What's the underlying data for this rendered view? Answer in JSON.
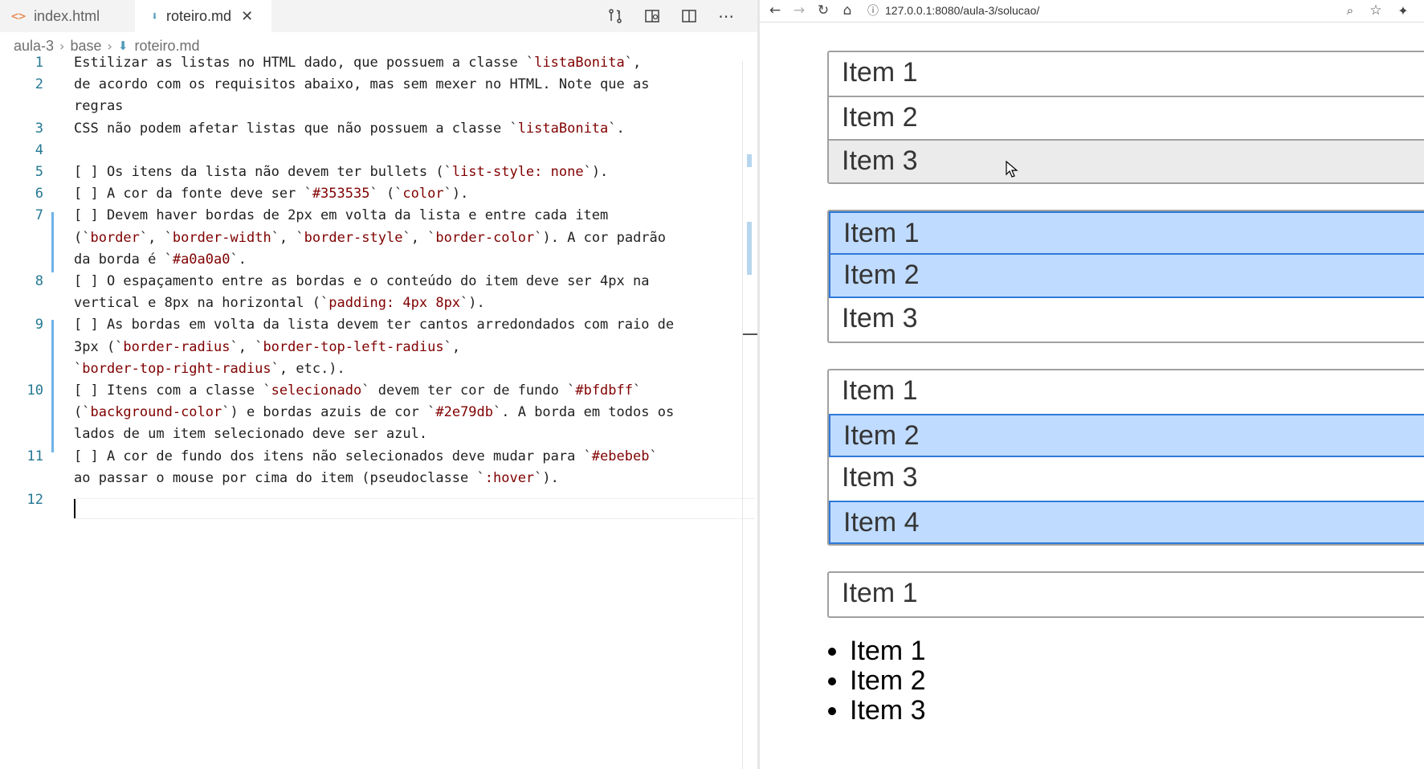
{
  "editor": {
    "tabs": [
      {
        "icon": "html-file-icon",
        "label": "index.html",
        "active": false
      },
      {
        "icon": "markdown-file-icon",
        "label": "roteiro.md",
        "active": true
      }
    ],
    "breadcrumb": [
      "aula-3",
      "base",
      "roteiro.md"
    ],
    "line_numbers": [
      "1",
      "2",
      "3",
      "4",
      "5",
      "6",
      "7",
      "8",
      "9",
      "10",
      "11",
      "12"
    ],
    "lines": [
      {
        "n": "1",
        "segs": [
          {
            "t": "Estilizar as listas no HTML dado, que possuem a classe `"
          },
          {
            "t": "listaBonita",
            "c": 1
          },
          {
            "t": "`,"
          }
        ]
      },
      {
        "segs": [
          {
            "t": "de acordo com os requisitos abaixo, mas sem mexer no HTML. Note que as"
          }
        ],
        "n": "2"
      },
      {
        "segs": [
          {
            "t": "regras"
          }
        ]
      },
      {
        "n": "3",
        "segs": [
          {
            "t": "CSS não podem afetar listas que não possuem a classe `"
          },
          {
            "t": "listaBonita",
            "c": 1
          },
          {
            "t": "`."
          }
        ]
      },
      {
        "n": "4",
        "segs": [
          {
            "t": ""
          }
        ]
      },
      {
        "n": "5",
        "segs": [
          {
            "t": "[ ] Os itens da lista não devem ter bullets (`"
          },
          {
            "t": "list-style: none",
            "c": 1
          },
          {
            "t": "`)."
          }
        ]
      },
      {
        "n": "6",
        "segs": [
          {
            "t": "[ ] A cor da fonte deve ser `"
          },
          {
            "t": "#353535",
            "c": 1
          },
          {
            "t": "` (`"
          },
          {
            "t": "color",
            "c": 1
          },
          {
            "t": "`)."
          }
        ]
      },
      {
        "n": "7",
        "segs": [
          {
            "t": "[ ] Devem haver bordas de 2px em volta da lista e entre cada item"
          }
        ]
      },
      {
        "segs": [
          {
            "t": "(`"
          },
          {
            "t": "border",
            "c": 1
          },
          {
            "t": "`, `"
          },
          {
            "t": "border-width",
            "c": 1
          },
          {
            "t": "`, `"
          },
          {
            "t": "border-style",
            "c": 1
          },
          {
            "t": "`, `"
          },
          {
            "t": "border-color",
            "c": 1
          },
          {
            "t": "`). A cor padrão"
          }
        ]
      },
      {
        "segs": [
          {
            "t": "da borda é `"
          },
          {
            "t": "#a0a0a0",
            "c": 1
          },
          {
            "t": "`."
          }
        ]
      },
      {
        "n": "8",
        "segs": [
          {
            "t": "[ ] O espaçamento entre as bordas e o conteúdo do item deve ser 4px na"
          }
        ]
      },
      {
        "segs": [
          {
            "t": "vertical e 8px na horizontal (`"
          },
          {
            "t": "padding: 4px 8px",
            "c": 1
          },
          {
            "t": "`)."
          }
        ]
      },
      {
        "n": "9",
        "segs": [
          {
            "t": "[ ] As bordas em volta da lista devem ter cantos arredondados com raio de"
          }
        ]
      },
      {
        "segs": [
          {
            "t": "3px (`"
          },
          {
            "t": "border-radius",
            "c": 1
          },
          {
            "t": "`, `"
          },
          {
            "t": "border-top-left-radius",
            "c": 1
          },
          {
            "t": "`,"
          }
        ]
      },
      {
        "segs": [
          {
            "t": "`"
          },
          {
            "t": "border-top-right-radius",
            "c": 1
          },
          {
            "t": "`, etc.)."
          }
        ]
      },
      {
        "n": "10",
        "segs": [
          {
            "t": "[ ] Itens com a classe `"
          },
          {
            "t": "selecionado",
            "c": 1
          },
          {
            "t": "` devem ter cor de fundo `"
          },
          {
            "t": "#bfdbff",
            "c": 1
          },
          {
            "t": "`"
          }
        ]
      },
      {
        "segs": [
          {
            "t": "(`"
          },
          {
            "t": "background-color",
            "c": 1
          },
          {
            "t": "`) e bordas azuis de cor `"
          },
          {
            "t": "#2e79db",
            "c": 1
          },
          {
            "t": "`. A borda em todos os"
          }
        ]
      },
      {
        "segs": [
          {
            "t": "lados de um item selecionado deve ser azul."
          }
        ]
      },
      {
        "n": "11",
        "segs": [
          {
            "t": "[ ] A cor de fundo dos itens não selecionados deve mudar para `"
          },
          {
            "t": "#ebebeb",
            "c": 1
          },
          {
            "t": "`"
          }
        ]
      },
      {
        "segs": [
          {
            "t": "ao passar o mouse por cima do item (pseudoclasse `"
          },
          {
            "t": ":hover",
            "c": 1
          },
          {
            "t": "`)."
          }
        ]
      },
      {
        "n": "12",
        "segs": [
          {
            "t": ""
          }
        ]
      }
    ],
    "colors": {
      "code": "#800000",
      "line_number": "#237893",
      "gutter_modified": "#6fb2e8"
    }
  },
  "browser": {
    "url": "127.0.0.1:8080/aula-3/solucao/",
    "lists": [
      {
        "items": [
          {
            "label": "Item 1",
            "state": "normal"
          },
          {
            "label": "Item 2",
            "state": "normal"
          },
          {
            "label": "Item 3",
            "state": "hover"
          }
        ]
      },
      {
        "items": [
          {
            "label": "Item 1",
            "state": "selected"
          },
          {
            "label": "Item 2",
            "state": "selected"
          },
          {
            "label": "Item 3",
            "state": "normal"
          }
        ]
      },
      {
        "items": [
          {
            "label": "Item 1",
            "state": "normal"
          },
          {
            "label": "Item 2",
            "state": "selected"
          },
          {
            "label": "Item 3",
            "state": "normal"
          },
          {
            "label": "Item 4",
            "state": "selected"
          }
        ]
      },
      {
        "items": [
          {
            "label": "Item 1",
            "state": "normal"
          }
        ]
      }
    ],
    "plain_list": [
      "Item 1",
      "Item 2",
      "Item 3"
    ],
    "colors": {
      "text": "#353535",
      "border": "#a0a0a0",
      "selected_bg": "#bfdbff",
      "selected_border": "#2e79db",
      "hover_bg": "#ebebeb"
    }
  }
}
